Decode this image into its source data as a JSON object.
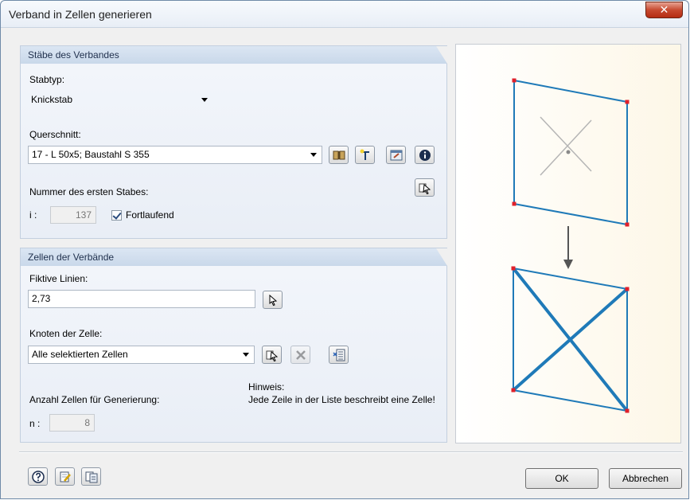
{
  "window": {
    "title": "Verband in Zellen generieren",
    "close_symbol": "✕"
  },
  "group_bars": {
    "header": "Stäbe des Verbandes",
    "stabtyp_label": "Stabtyp:",
    "stabtyp_value": "Knickstab",
    "querschnitt_label": "Querschnitt:",
    "querschnitt_value": "17 - L 50x5; Baustahl S 355",
    "first_bar_label": "Nummer des ersten Stabes:",
    "first_bar_prefix": "i :",
    "first_bar_value": "137",
    "fortlaufend_label": "Fortlaufend",
    "fortlaufend_checked": true
  },
  "group_cells": {
    "header": "Zellen der Verbände",
    "fictive_label": "Fiktive Linien:",
    "fictive_value": "2,73",
    "nodes_label": "Knoten der Zelle:",
    "nodes_value": "Alle selektierten Zellen",
    "count_label": "Anzahl Zellen für Generierung:",
    "count_prefix": "n :",
    "count_value": "8",
    "hint_title": "Hinweis:",
    "hint_text": "Jede Zeile in der Liste beschreibt eine Zelle!"
  },
  "footer": {
    "ok_label": "OK",
    "cancel_label": "Abbrechen"
  },
  "colors": {
    "frame": "#1f7ab8",
    "node": "#e0202a",
    "accent_header": "#c9d8ea"
  }
}
